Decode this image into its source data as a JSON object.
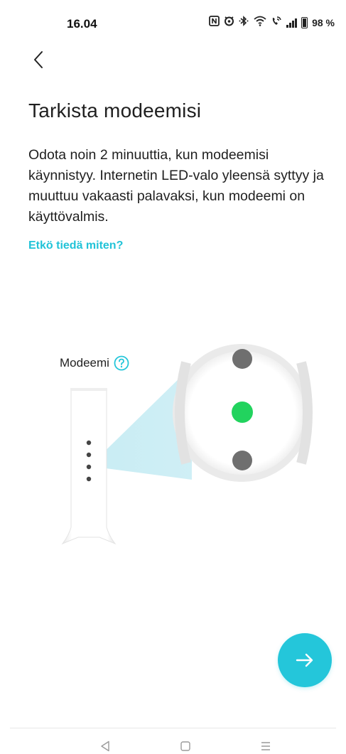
{
  "status_bar": {
    "time": "16.04",
    "battery_text": "98 %",
    "icons": [
      "nfc-icon",
      "alarm-icon",
      "bluetooth-icon",
      "wifi-icon",
      "volte-icon",
      "signal-icon",
      "battery-icon"
    ]
  },
  "header": {
    "back_icon": "chevron-left-icon"
  },
  "main": {
    "title": "Tarkista modeemisi",
    "description": "Odota noin 2 minuuttia, kun modeemisi käynnistyy. Internetin LED-valo yleensä syttyy ja muuttuu vakaasti palavaksi, kun modeemi on käyttövalmis.",
    "help_link": "Etkö tiedä miten?"
  },
  "illustration": {
    "modem_label": "Modeemi",
    "help_icon": "question-circle-icon",
    "leds": [
      {
        "state": "off",
        "color": "#707070"
      },
      {
        "state": "on",
        "color": "#22d35e"
      },
      {
        "state": "off",
        "color": "#707070"
      }
    ]
  },
  "footer": {
    "next_icon": "arrow-right-icon",
    "accent_color": "#24c6da"
  },
  "nav_bar": {
    "items": [
      "back-triangle-icon",
      "home-square-icon",
      "menu-lines-icon"
    ]
  }
}
